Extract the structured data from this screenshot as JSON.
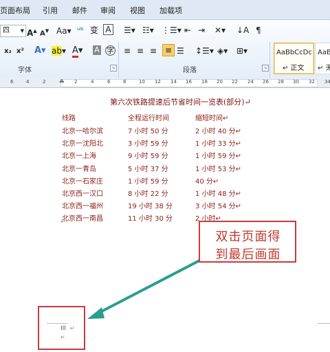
{
  "ribbon": {
    "tabs": [
      "页面布局",
      "引用",
      "邮件",
      "审阅",
      "视图",
      "加载项"
    ],
    "font_size": "四",
    "groups": {
      "font": "字体",
      "paragraph": "段落"
    },
    "styles": {
      "normal_sample": "AaBbCcDc",
      "normal_label": "↵ 正文",
      "next_sample": "AaBb",
      "next_label": "↵ 无"
    }
  },
  "ruler": {
    "ticks": [
      "6",
      "4",
      "2",
      "2",
      "4",
      "6",
      "8",
      "10",
      "12",
      "14",
      "16",
      "18",
      "20",
      "22",
      "24",
      "26",
      "28",
      "30",
      "32",
      "34"
    ]
  },
  "document": {
    "title": "第六次铁路提速后节省时间一览表(部分)↵",
    "headers": [
      "线路",
      "全程运行时间",
      "缩短时间↵"
    ],
    "rows": [
      [
        "北京一哈尔滨",
        "7 小时 50 分",
        "2 小时 40 分↵"
      ],
      [
        "北京一沈阳北",
        "3 小时 59 分",
        "1 小时 33 分↵"
      ],
      [
        "北京一上海",
        "9 小时 59 分",
        "1 小时 59 分↵"
      ],
      [
        "北京一青岛",
        "5 小时 37 分",
        "1 小时 53 分↵"
      ],
      [
        "北京一石家庄",
        "1 小时 59 分",
        "40 分↵"
      ],
      [
        "北京西一汉口",
        "8 小时 22 分",
        "1 小时 48 分↵"
      ],
      [
        "北京西一福州",
        "19 小时 38 分",
        "3 小时 54 分↵"
      ],
      [
        "北京西一南昌",
        "11 小时 30 分",
        "2 小时↵"
      ]
    ],
    "end_mark": "↵",
    "footer_field": "III",
    "footer_mark": "↵"
  },
  "annotation": {
    "line1": "双击页面得",
    "line2": "到最后画面"
  },
  "colors": {
    "accent_red": "#c9393a",
    "arrow_teal": "#2a9d8f",
    "doc_text": "#8b1d14"
  }
}
